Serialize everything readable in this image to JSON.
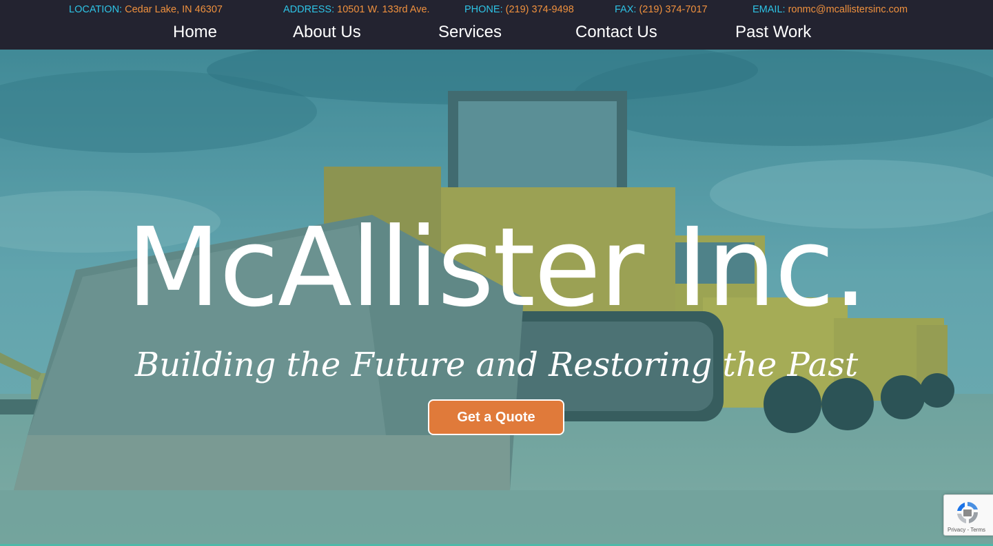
{
  "contact": {
    "location": {
      "label": "LOCATION:",
      "value": "Cedar Lake, IN 46307"
    },
    "address": {
      "label": "ADDRESS:",
      "value": "10501 W. 133rd Ave."
    },
    "phone": {
      "label": "PHONE:",
      "value": "(219) 374-9498"
    },
    "fax": {
      "label": "FAX:",
      "value": "(219) 374-7017"
    },
    "email": {
      "label": "EMAIL:",
      "value": "ronmc@mcallistersinc.com"
    }
  },
  "nav": {
    "home": "Home",
    "about": "About Us",
    "services": "Services",
    "contact": "Contact Us",
    "past_work": "Past Work"
  },
  "hero": {
    "title": "McAllister Inc.",
    "tagline": "Building the Future and Restoring the Past",
    "cta": "Get a Quote"
  },
  "recaptcha": {
    "privacy": "Privacy",
    "separator": " - ",
    "terms": "Terms"
  },
  "colors": {
    "topbar_bg": "#232330",
    "label": "#2ec4e6",
    "value": "#f0913e",
    "cta_bg": "#e07a3a"
  }
}
